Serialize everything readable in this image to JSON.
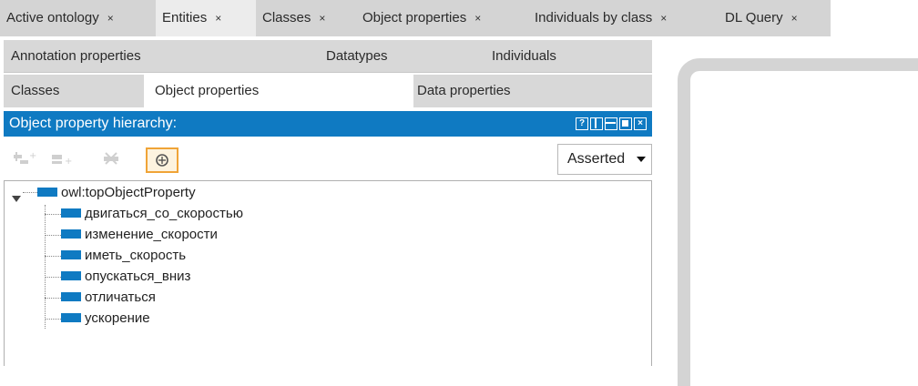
{
  "tabs": [
    {
      "label": "Active ontology",
      "close": "×"
    },
    {
      "label": "Entities",
      "close": "×"
    },
    {
      "label": "Classes",
      "close": "×"
    },
    {
      "label": "Object properties",
      "close": "×"
    },
    {
      "label": "Individuals by class",
      "close": "×"
    },
    {
      "label": "DL Query",
      "close": "×"
    }
  ],
  "entity_tabs": {
    "row1": [
      "Annotation properties",
      "Datatypes",
      "Individuals"
    ],
    "row2": [
      "Classes",
      "Object properties",
      "Data properties"
    ]
  },
  "hierarchy": {
    "title": "Object property hierarchy:",
    "view_mode": "Asserted",
    "root": "owl:topObjectProperty",
    "children": [
      "двигаться_со_скоростью",
      "изменение_скорости",
      "иметь_скорость",
      "опускаться_вниз",
      "отличаться",
      "ускорение"
    ]
  },
  "header_icons": [
    "help-icon",
    "split-vertical-icon",
    "split-horizontal-icon",
    "maximize-icon",
    "close-icon"
  ],
  "colors": {
    "accent": "#0f7ac2",
    "highlight": "#f0a437"
  }
}
